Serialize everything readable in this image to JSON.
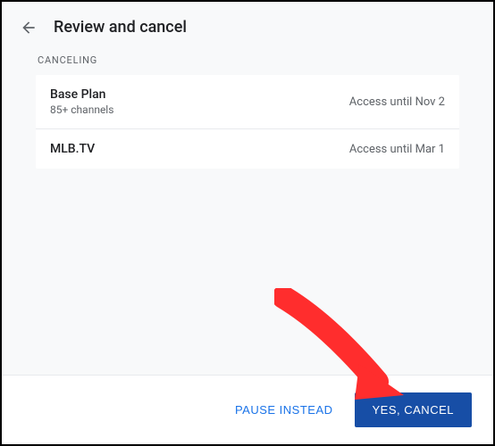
{
  "header": {
    "title": "Review and cancel"
  },
  "section": {
    "label": "CANCELING"
  },
  "items": [
    {
      "title": "Base Plan",
      "subtitle": "85+ channels",
      "status": "Access until Nov 2"
    },
    {
      "title": "MLB.TV",
      "subtitle": "",
      "status": "Access until Mar 1"
    }
  ],
  "footer": {
    "secondary_label": "PAUSE INSTEAD",
    "primary_label": "YES, CANCEL"
  },
  "colors": {
    "primary_button_bg": "#174ea6",
    "secondary_text": "#1a73e8",
    "annotation": "#ff2d2d"
  }
}
